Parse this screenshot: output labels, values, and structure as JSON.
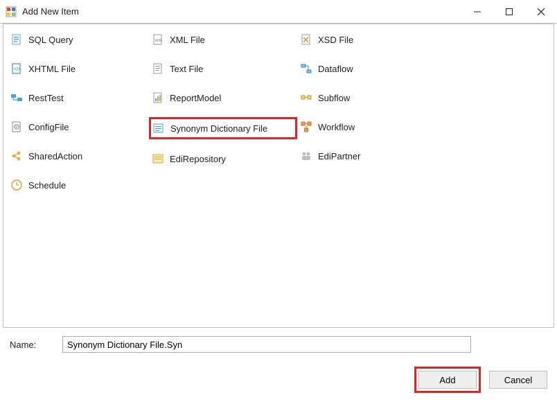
{
  "window": {
    "title": "Add New Item"
  },
  "items": {
    "colA": [
      {
        "label": "SQL Query",
        "icon": "sql-icon"
      },
      {
        "label": "XHTML File",
        "icon": "xhtml-icon"
      },
      {
        "label": "RestTest",
        "icon": "rest-icon"
      },
      {
        "label": "ConfigFile",
        "icon": "config-icon"
      },
      {
        "label": "SharedAction",
        "icon": "shared-action-icon"
      },
      {
        "label": "Schedule",
        "icon": "schedule-icon"
      }
    ],
    "colB": [
      {
        "label": "XML File",
        "icon": "xml-icon"
      },
      {
        "label": "Text File",
        "icon": "text-icon"
      },
      {
        "label": "ReportModel",
        "icon": "report-icon"
      },
      {
        "label": "Synonym Dictionary File",
        "icon": "synonym-icon",
        "highlighted": true
      },
      {
        "label": "EdiRepository",
        "icon": "edi-repo-icon"
      }
    ],
    "colC": [
      {
        "label": "XSD File",
        "icon": "xsd-icon"
      },
      {
        "label": "Dataflow",
        "icon": "dataflow-icon"
      },
      {
        "label": "Subflow",
        "icon": "subflow-icon"
      },
      {
        "label": "Workflow",
        "icon": "workflow-icon"
      },
      {
        "label": "EdiPartner",
        "icon": "edi-partner-icon"
      }
    ]
  },
  "footer": {
    "name_label": "Name:",
    "name_value": "Synonym Dictionary File.Syn",
    "add_label": "Add",
    "cancel_label": "Cancel"
  }
}
